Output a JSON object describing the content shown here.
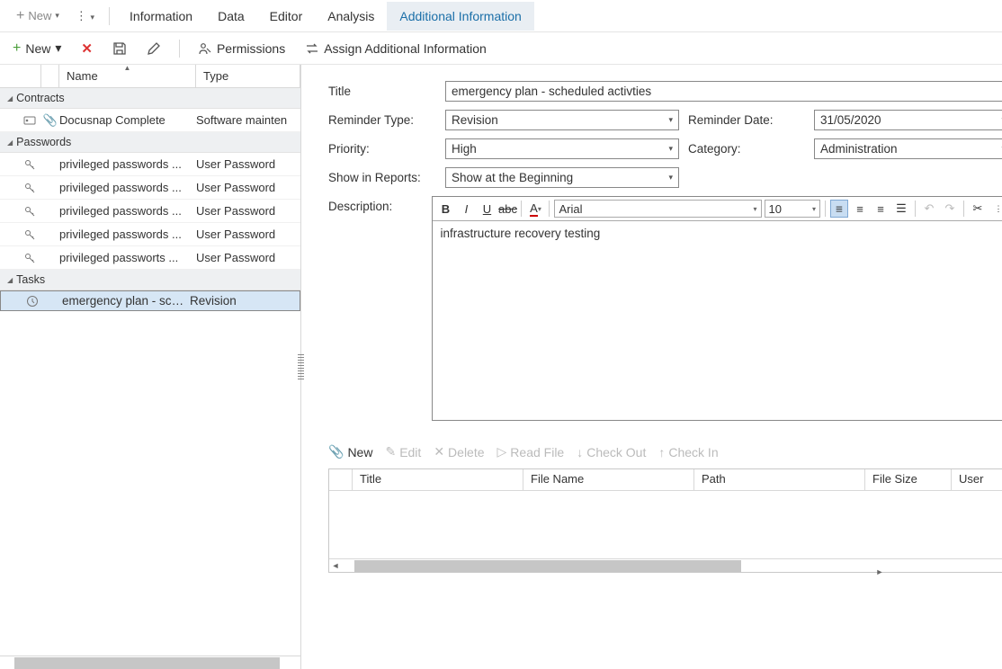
{
  "ribbon": {
    "new": "New",
    "tabs": [
      "Information",
      "Data",
      "Editor",
      "Analysis",
      "Additional Information"
    ],
    "active_tab": 4
  },
  "toolbar": {
    "new": "New",
    "permissions": "Permissions",
    "assign": "Assign Additional Information"
  },
  "grid": {
    "columns": {
      "name": "Name",
      "type": "Type"
    },
    "groups": [
      {
        "label": "Contracts",
        "rows": [
          {
            "icon": "card",
            "name": "Docusnap Complete",
            "type": "Software mainten"
          }
        ]
      },
      {
        "label": "Passwords",
        "rows": [
          {
            "icon": "key",
            "name": "privileged passwords ...",
            "type": "User Password"
          },
          {
            "icon": "key",
            "name": "privileged passwords ...",
            "type": "User Password"
          },
          {
            "icon": "key",
            "name": "privileged passwords ...",
            "type": "User Password"
          },
          {
            "icon": "key",
            "name": "privileged passwords ...",
            "type": "User Password"
          },
          {
            "icon": "key",
            "name": "privileged passworts ...",
            "type": "User Password"
          }
        ]
      },
      {
        "label": "Tasks",
        "rows": [
          {
            "icon": "clock",
            "name": "emergency plan - sch...",
            "type": "Revision",
            "selected": true
          }
        ]
      }
    ]
  },
  "form": {
    "labels": {
      "title": "Title",
      "reminder_type": "Reminder Type:",
      "reminder_date": "Reminder Date:",
      "priority": "Priority:",
      "category": "Category:",
      "show_in_reports": "Show in Reports:",
      "description": "Description:"
    },
    "values": {
      "title": "emergency plan - scheduled activties",
      "reminder_type": "Revision",
      "reminder_date": "31/05/2020",
      "priority": "High",
      "category": "Administration",
      "show_in_reports": "Show at the Beginning",
      "description": "infrastructure recovery testing"
    }
  },
  "editor_toolbar": {
    "font": "Arial",
    "size": "10"
  },
  "attachments": {
    "buttons": {
      "new": "New",
      "edit": "Edit",
      "delete": "Delete",
      "read_file": "Read File",
      "check_out": "Check Out",
      "check_in": "Check In"
    },
    "columns": [
      "Title",
      "File Name",
      "Path",
      "File Size",
      "User"
    ]
  }
}
